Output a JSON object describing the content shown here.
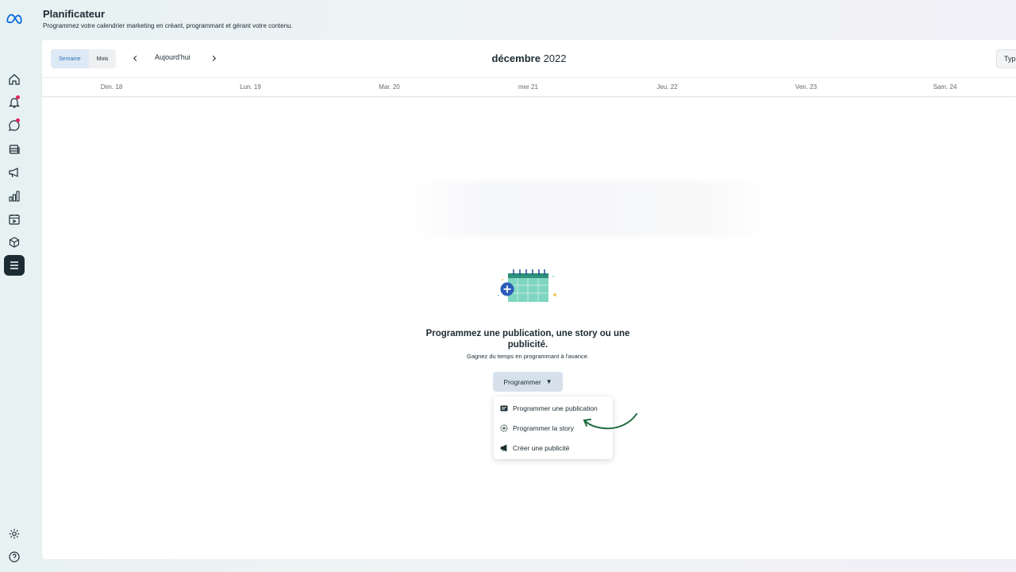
{
  "header": {
    "title": "Planificateur",
    "subtitle": "Programmez votre calendrier marketing en créant, programmant et gérant votre contenu."
  },
  "toolbar": {
    "view_week": "Semaine",
    "view_month": "Mois",
    "today": "Aujourd'hui",
    "month": "décembre",
    "year": "2022",
    "type_button": "Typ"
  },
  "days": [
    "Dim. 18",
    "Lun. 19",
    "Mar. 20",
    "mer 21",
    "Jeu. 22",
    "Ven. 23",
    "Sam. 24"
  ],
  "empty_state": {
    "title": "Programmez une publication, une story ou une publicité.",
    "subtitle": "Gagnez du temps en programmant à l'avance.",
    "button": "Programmer"
  },
  "menu": {
    "items": [
      "Programmer une publication",
      "Programmer la story",
      "Créer une publicité"
    ]
  },
  "colors": {
    "accent": "#2f6fb8",
    "active_rail": "#1c2b33",
    "notification": "#e0245e",
    "arrow": "#1d6b3f"
  }
}
